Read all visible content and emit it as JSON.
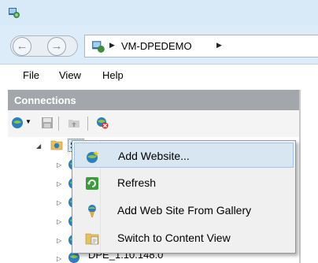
{
  "window": {
    "app_icon": "iis-manager-icon"
  },
  "nav": {
    "back_icon": "back-arrow-icon",
    "forward_icon": "forward-arrow-icon",
    "address_segment": "VM-DPEDEMO"
  },
  "menu": {
    "file": "File",
    "view": "View",
    "help": "Help"
  },
  "connections": {
    "title": "Connections",
    "toolbar_icons": [
      "connect-icon",
      "save-icon",
      "up-folder-icon",
      "disconnect-icon"
    ]
  },
  "tree": {
    "sites_label": "Sit",
    "partial_node_label": "DPE_1.10.148.0"
  },
  "context_menu": {
    "items": [
      {
        "label": "Add Website...",
        "icon": "add-website-icon"
      },
      {
        "label": "Refresh",
        "icon": "refresh-icon"
      },
      {
        "label": "Add Web Site From Gallery",
        "icon": "gallery-icon"
      },
      {
        "label": "Switch to Content View",
        "icon": "content-view-icon"
      }
    ]
  },
  "colors": {
    "nav_bg": "#dcecf9",
    "pane_header": "#a3a7ab",
    "menu_highlight": "#d8e6f2",
    "menu_highlight_border": "#9fc4e6"
  }
}
